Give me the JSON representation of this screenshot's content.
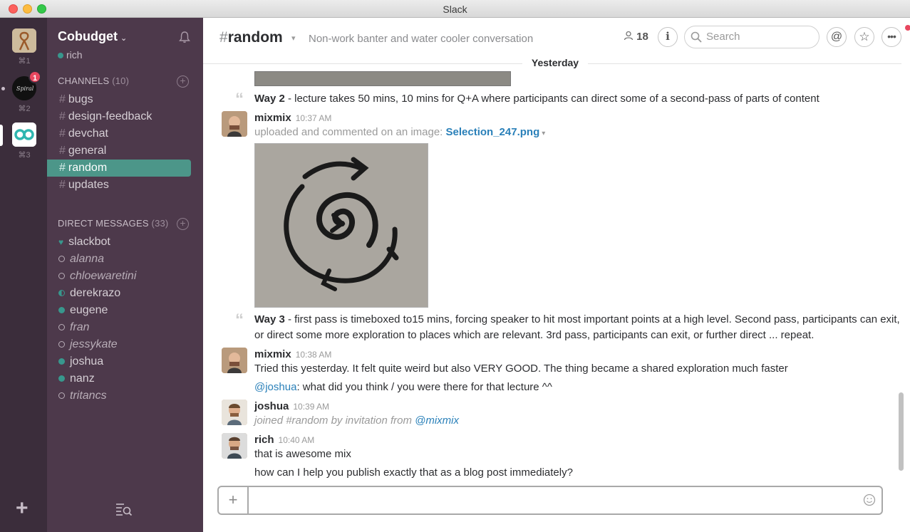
{
  "window": {
    "title": "Slack"
  },
  "teams": [
    {
      "key": "⌘1",
      "badge": ""
    },
    {
      "key": "⌘2",
      "badge": "1"
    },
    {
      "key": "⌘3",
      "badge": ""
    }
  ],
  "sidebar": {
    "team_name": "Cobudget",
    "user": "rich",
    "channels_label": "CHANNELS",
    "channels_count": "(10)",
    "channels": [
      "bugs",
      "design-feedback",
      "devchat",
      "general",
      "random",
      "updates"
    ],
    "dms_label": "DIRECT MESSAGES",
    "dms_count": "(33)",
    "dms": [
      {
        "name": "slackbot",
        "status": "heart"
      },
      {
        "name": "alanna",
        "status": "away"
      },
      {
        "name": "chloewaretini",
        "status": "offline"
      },
      {
        "name": "derekrazo",
        "status": "half"
      },
      {
        "name": "eugene",
        "status": "online"
      },
      {
        "name": "fran",
        "status": "away"
      },
      {
        "name": "jessykate",
        "status": "offline"
      },
      {
        "name": "joshua",
        "status": "online"
      },
      {
        "name": "nanz",
        "status": "online"
      },
      {
        "name": "tritancs",
        "status": "offline"
      }
    ]
  },
  "header": {
    "hash": "#",
    "channel": "random",
    "purpose": "Non-work banter and water cooler conversation",
    "member_count": "18",
    "search_placeholder": "Search"
  },
  "messages": {
    "day_divider": "Yesterday",
    "way2_bold": "Way 2",
    "way2_text": " - lecture takes 50 mins, 10 mins for Q+A where participants can direct some of a second-pass of parts of content",
    "m1_author": "mixmix",
    "m1_time": "10:37 AM",
    "m1_upload_text": "uploaded and commented on an image: ",
    "m1_file": "Selection_247.png",
    "way3_bold": "Way 3",
    "way3_line1": " - first pass is timeboxed to15 mins, forcing speaker to hit most important points at a high level. Second pass, participants can exit,",
    "way3_line2": "or direct some more exploration to places which are relevant. 3rd pass, participants can exit,  or further direct ... repeat.",
    "m2_author": "mixmix",
    "m2_time": "10:38 AM",
    "m2_text1": "Tried this yesterday. It felt quite weird but also VERY GOOD. The thing became a shared exploration much faster",
    "m2_mention": "@joshua",
    "m2_text2": ": what did you think / you were there for that lecture ^^",
    "m3_author": "joshua",
    "m3_time": "10:39 AM",
    "m3_text": "joined #random by invitation from ",
    "m3_mention": "@mixmix",
    "m4_author": "rich",
    "m4_time": "10:40 AM",
    "m4_text1": "that is awesome mix",
    "m4_text2": "how can I help you publish exactly that as a blog post immediately?"
  },
  "composer": {
    "placeholder": ""
  },
  "colors": {
    "sidebar": "#4d394b",
    "teams": "#3b2d3b",
    "active": "#4c9689",
    "link": "#2a80b9",
    "badge": "#e8475f"
  }
}
